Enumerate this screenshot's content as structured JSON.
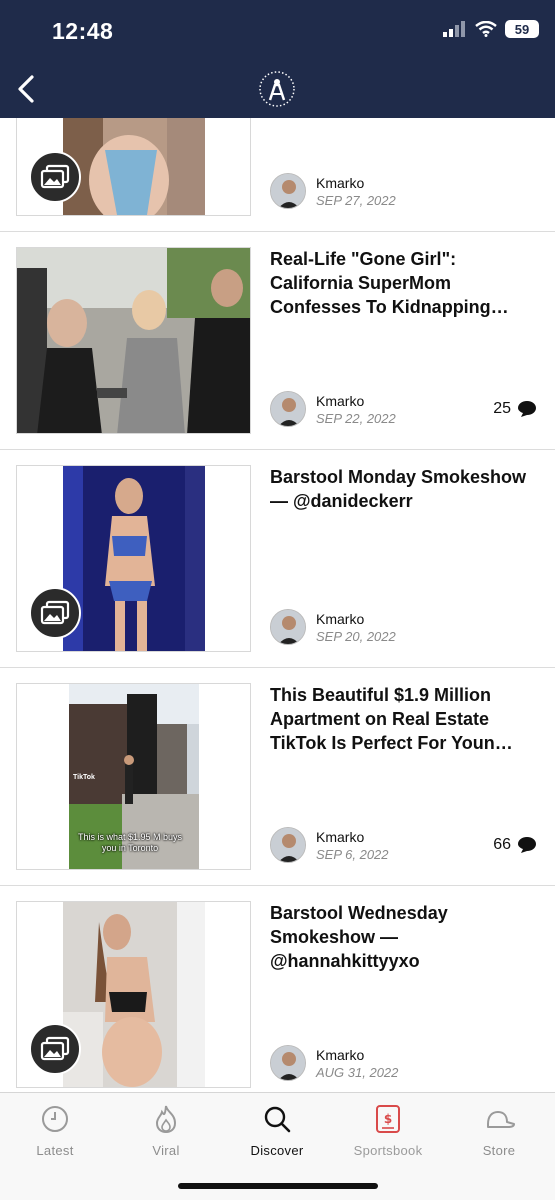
{
  "status_bar": {
    "time": "12:48",
    "battery": "59"
  },
  "header": {
    "back_icon": "chevron-left-icon",
    "logo_icon": "barstool-logo-icon",
    "colors": {
      "background": "#1f2b4a"
    }
  },
  "articles": [
    {
      "title": "",
      "author": "Kmarko",
      "date": "SEP 27, 2022",
      "comments": "",
      "gallery": true
    },
    {
      "title": "Real-Life \"Gone Girl\": California SuperMom Confesses To Kidnapping…",
      "author": "Kmarko",
      "date": "SEP 22, 2022",
      "comments": "25",
      "gallery": false
    },
    {
      "title": "Barstool Monday Smokeshow — @danideckerr",
      "author": "Kmarko",
      "date": "SEP 20, 2022",
      "comments": "",
      "gallery": true
    },
    {
      "title": "This Beautiful $1.9 Million Apartment on Real Estate TikTok Is Perfect For Youn…",
      "author": "Kmarko",
      "date": "SEP 6, 2022",
      "comments": "66",
      "gallery": false,
      "image_caption": "This is what $1.95 M buys you in Toronto",
      "image_watermark": "TikTok"
    },
    {
      "title": "Barstool Wednesday Smokeshow — @hannahkittyyxo",
      "author": "Kmarko",
      "date": "AUG 31, 2022",
      "comments": "",
      "gallery": true
    }
  ],
  "tabbar": {
    "tabs": [
      {
        "label": "Latest",
        "icon": "clock-icon"
      },
      {
        "label": "Viral",
        "icon": "flame-icon"
      },
      {
        "label": "Discover",
        "icon": "search-icon",
        "active": true
      },
      {
        "label": "Sportsbook",
        "icon": "ticket-icon"
      },
      {
        "label": "Store",
        "icon": "hat-icon"
      }
    ]
  }
}
